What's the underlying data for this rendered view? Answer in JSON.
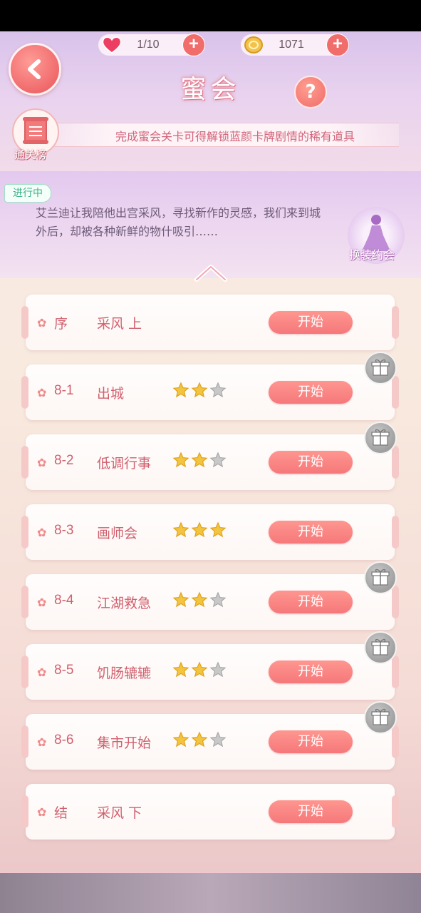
{
  "header": {
    "hearts": {
      "value": "1/10",
      "icon": "heart-icon"
    },
    "coins": {
      "value": "1071",
      "icon": "coin-icon"
    },
    "title": "蜜会",
    "help_label": "?",
    "banner_text": "完成蜜会关卡可得解锁蓝颜卡牌剧情的稀有道具",
    "rank_label": "通关榜"
  },
  "story": {
    "status_tag": "进行中",
    "description": "艾兰迪让我陪他出宫采风，寻找新作的灵感，我们来到城外后，却被各种新鲜的物什吸引……",
    "dress_label": "换装约会"
  },
  "levels": [
    {
      "id": "序",
      "name": "采风 上",
      "stars": null,
      "button": "开始",
      "gift": false
    },
    {
      "id": "8-1",
      "name": "出城",
      "stars": 2,
      "button": "开始",
      "gift": true
    },
    {
      "id": "8-2",
      "name": "低调行事",
      "stars": 2,
      "button": "开始",
      "gift": true
    },
    {
      "id": "8-3",
      "name": "画师会",
      "stars": 3,
      "button": "开始",
      "gift": false
    },
    {
      "id": "8-4",
      "name": "江湖救急",
      "stars": 2,
      "button": "开始",
      "gift": true
    },
    {
      "id": "8-5",
      "name": "饥肠辘辘",
      "stars": 2,
      "button": "开始",
      "gift": true
    },
    {
      "id": "8-6",
      "name": "集市开始",
      "stars": 2,
      "button": "开始",
      "gift": true
    },
    {
      "id": "结",
      "name": "采风 下",
      "stars": null,
      "button": "开始",
      "gift": false
    }
  ],
  "colors": {
    "accent": "#f0706f",
    "star_gold": "#f3c43f",
    "star_grey": "#c8c8c8",
    "text_pink": "#d0606e"
  }
}
